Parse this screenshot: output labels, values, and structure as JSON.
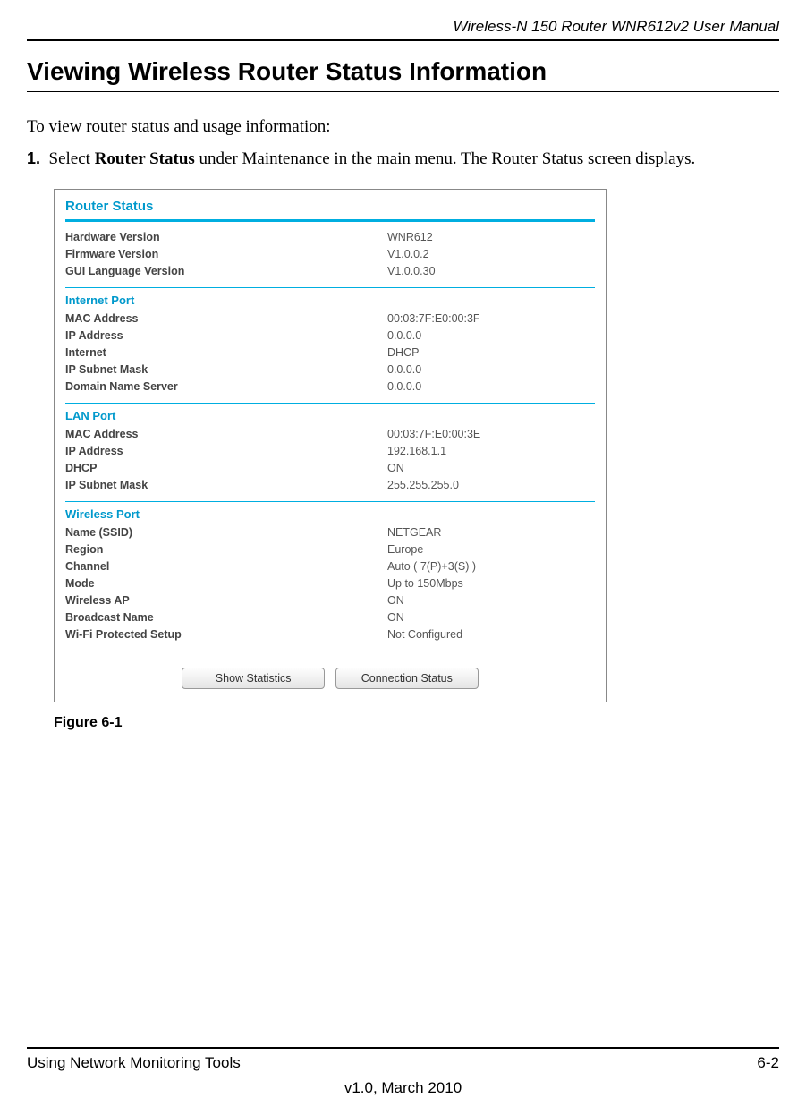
{
  "header": {
    "manual_title": "Wireless-N 150 Router WNR612v2 User Manual"
  },
  "section": {
    "title": "Viewing Wireless Router Status Information",
    "intro": "To view router status and usage information:",
    "step_number": "1.",
    "step_text_prefix": "Select ",
    "step_text_bold": "Router Status",
    "step_text_suffix": " under Maintenance in the main menu. The Router Status screen displays."
  },
  "panel": {
    "title": "Router Status",
    "general": [
      {
        "label": "Hardware Version",
        "value": "WNR612"
      },
      {
        "label": "Firmware Version",
        "value": "V1.0.0.2"
      },
      {
        "label": "GUI Language Version",
        "value": "V1.0.0.30"
      }
    ],
    "internet": {
      "head": "Internet Port",
      "rows": [
        {
          "label": "MAC Address",
          "value": "00:03:7F:E0:00:3F"
        },
        {
          "label": "IP Address",
          "value": "0.0.0.0"
        },
        {
          "label": "Internet",
          "value": "DHCP"
        },
        {
          "label": "IP Subnet Mask",
          "value": "0.0.0.0"
        },
        {
          "label": "Domain Name Server",
          "value": "0.0.0.0"
        }
      ]
    },
    "lan": {
      "head": "LAN Port",
      "rows": [
        {
          "label": "MAC Address",
          "value": "00:03:7F:E0:00:3E"
        },
        {
          "label": "IP Address",
          "value": "192.168.1.1"
        },
        {
          "label": "DHCP",
          "value": "ON"
        },
        {
          "label": "IP Subnet Mask",
          "value": "255.255.255.0"
        }
      ]
    },
    "wireless": {
      "head": "Wireless Port",
      "rows": [
        {
          "label": "Name (SSID)",
          "value": "NETGEAR"
        },
        {
          "label": "Region",
          "value": "Europe"
        },
        {
          "label": "Channel",
          "value": "Auto ( 7(P)+3(S) )"
        },
        {
          "label": "Mode",
          "value": "Up to 150Mbps"
        },
        {
          "label": "Wireless AP",
          "value": "ON"
        },
        {
          "label": "Broadcast Name",
          "value": "ON"
        },
        {
          "label": "Wi-Fi Protected Setup",
          "value": "Not Configured"
        }
      ]
    },
    "buttons": {
      "show_stats": "Show Statistics",
      "conn_status": "Connection Status"
    }
  },
  "figure_caption": "Figure 6-1",
  "footer": {
    "left": "Using Network Monitoring Tools",
    "right": "6-2",
    "center": "v1.0, March 2010"
  }
}
